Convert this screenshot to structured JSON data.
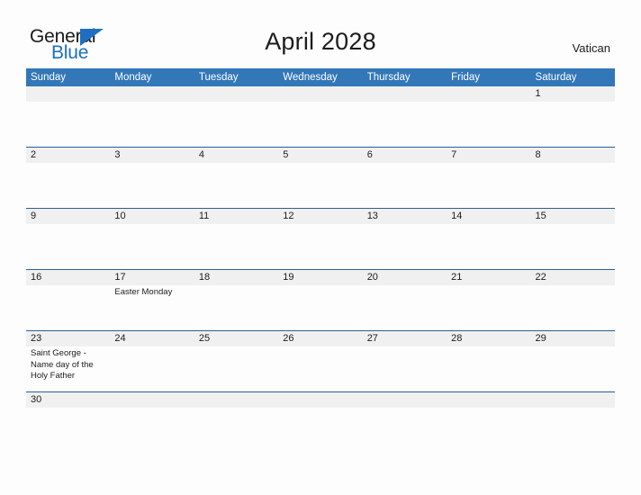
{
  "brand": {
    "name_top": "General",
    "name_bottom": "Blue",
    "accent_color": "#1f6fc0"
  },
  "header": {
    "title": "April 2028",
    "region": "Vatican"
  },
  "theme": {
    "header_blue": "#3277b8",
    "rule_blue": "#2a6099",
    "date_strip_gray": "#f0f0f0",
    "page_background": "#fdfdfd",
    "text_color": "#1c1c1c"
  },
  "calendar": {
    "weekdays": [
      "Sunday",
      "Monday",
      "Tuesday",
      "Wednesday",
      "Thursday",
      "Friday",
      "Saturday"
    ],
    "weeks": [
      {
        "dates": [
          "",
          "",
          "",
          "",
          "",
          "",
          "1"
        ],
        "events": [
          "",
          "",
          "",
          "",
          "",
          "",
          ""
        ]
      },
      {
        "dates": [
          "2",
          "3",
          "4",
          "5",
          "6",
          "7",
          "8"
        ],
        "events": [
          "",
          "",
          "",
          "",
          "",
          "",
          ""
        ]
      },
      {
        "dates": [
          "9",
          "10",
          "11",
          "12",
          "13",
          "14",
          "15"
        ],
        "events": [
          "",
          "",
          "",
          "",
          "",
          "",
          ""
        ]
      },
      {
        "dates": [
          "16",
          "17",
          "18",
          "19",
          "20",
          "21",
          "22"
        ],
        "events": [
          "",
          "Easter Monday",
          "",
          "",
          "",
          "",
          ""
        ]
      },
      {
        "dates": [
          "23",
          "24",
          "25",
          "26",
          "27",
          "28",
          "29"
        ],
        "events": [
          "Saint George - Name day of the Holy Father",
          "",
          "",
          "",
          "",
          "",
          ""
        ]
      },
      {
        "dates": [
          "30",
          "",
          "",
          "",
          "",
          "",
          ""
        ],
        "events": [
          "",
          "",
          "",
          "",
          "",
          "",
          ""
        ]
      }
    ]
  }
}
